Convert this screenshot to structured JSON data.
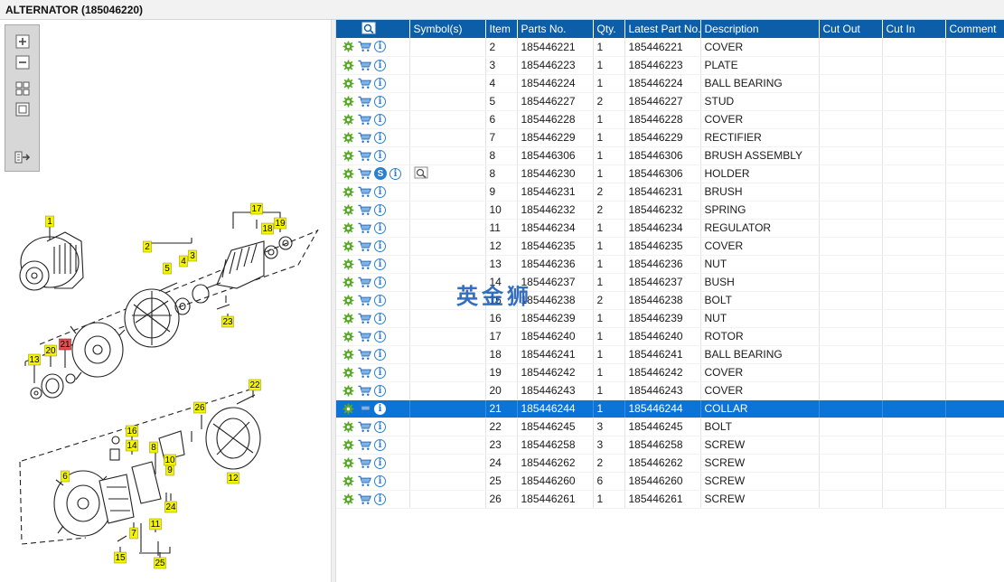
{
  "window": {
    "title": "ALTERNATOR (185046220)"
  },
  "toolbar": {
    "zoom_in": "zoom-in-icon",
    "zoom_out": "zoom-out-icon",
    "fit_all": "fit-all-icon",
    "fit_page": "fit-page-icon",
    "export": "export-icon"
  },
  "table": {
    "columns": [
      "",
      "Symbol(s)",
      "Item",
      "Parts No.",
      "Qty.",
      "Latest Part No.",
      "Description",
      "Cut Out",
      "Cut In",
      "Comment"
    ],
    "rows": [
      {
        "item": "2",
        "part": "185446221",
        "qty": "1",
        "latest": "185446221",
        "desc": "COVER"
      },
      {
        "item": "3",
        "part": "185446223",
        "qty": "1",
        "latest": "185446223",
        "desc": "PLATE"
      },
      {
        "item": "4",
        "part": "185446224",
        "qty": "1",
        "latest": "185446224",
        "desc": "BALL BEARING"
      },
      {
        "item": "5",
        "part": "185446227",
        "qty": "2",
        "latest": "185446227",
        "desc": "STUD"
      },
      {
        "item": "6",
        "part": "185446228",
        "qty": "1",
        "latest": "185446228",
        "desc": "COVER"
      },
      {
        "item": "7",
        "part": "185446229",
        "qty": "1",
        "latest": "185446229",
        "desc": "RECTIFIER"
      },
      {
        "item": "8",
        "part": "185446306",
        "qty": "1",
        "latest": "185446306",
        "desc": "BRUSH ASSEMBLY"
      },
      {
        "item": "8",
        "part": "185446230",
        "qty": "1",
        "latest": "185446306",
        "desc": "HOLDER",
        "has_s": true,
        "has_symbol": true
      },
      {
        "item": "9",
        "part": "185446231",
        "qty": "2",
        "latest": "185446231",
        "desc": "BRUSH"
      },
      {
        "item": "10",
        "part": "185446232",
        "qty": "2",
        "latest": "185446232",
        "desc": "SPRING"
      },
      {
        "item": "11",
        "part": "185446234",
        "qty": "1",
        "latest": "185446234",
        "desc": "REGULATOR"
      },
      {
        "item": "12",
        "part": "185446235",
        "qty": "1",
        "latest": "185446235",
        "desc": "COVER"
      },
      {
        "item": "13",
        "part": "185446236",
        "qty": "1",
        "latest": "185446236",
        "desc": "NUT"
      },
      {
        "item": "14",
        "part": "185446237",
        "qty": "1",
        "latest": "185446237",
        "desc": "BUSH"
      },
      {
        "item": "15",
        "part": "185446238",
        "qty": "2",
        "latest": "185446238",
        "desc": "BOLT"
      },
      {
        "item": "16",
        "part": "185446239",
        "qty": "1",
        "latest": "185446239",
        "desc": "NUT"
      },
      {
        "item": "17",
        "part": "185446240",
        "qty": "1",
        "latest": "185446240",
        "desc": "ROTOR"
      },
      {
        "item": "18",
        "part": "185446241",
        "qty": "1",
        "latest": "185446241",
        "desc": "BALL BEARING"
      },
      {
        "item": "19",
        "part": "185446242",
        "qty": "1",
        "latest": "185446242",
        "desc": "COVER"
      },
      {
        "item": "20",
        "part": "185446243",
        "qty": "1",
        "latest": "185446243",
        "desc": "COVER"
      },
      {
        "item": "21",
        "part": "185446244",
        "qty": "1",
        "latest": "185446244",
        "desc": "COLLAR",
        "selected": true
      },
      {
        "item": "22",
        "part": "185446245",
        "qty": "3",
        "latest": "185446245",
        "desc": "BOLT"
      },
      {
        "item": "23",
        "part": "185446258",
        "qty": "3",
        "latest": "185446258",
        "desc": "SCREW"
      },
      {
        "item": "24",
        "part": "185446262",
        "qty": "2",
        "latest": "185446262",
        "desc": "SCREW"
      },
      {
        "item": "25",
        "part": "185446260",
        "qty": "6",
        "latest": "185446260",
        "desc": "SCREW"
      },
      {
        "item": "26",
        "part": "185446261",
        "qty": "1",
        "latest": "185446261",
        "desc": "SCREW"
      }
    ]
  },
  "diagram": {
    "labels": [
      "1",
      "2",
      "3",
      "4",
      "5",
      "6",
      "7",
      "8",
      "9",
      "10",
      "11",
      "12",
      "13",
      "14",
      "15",
      "16",
      "17",
      "18",
      "19",
      "20",
      "21",
      "22",
      "23",
      "24",
      "25",
      "26"
    ],
    "active_label": "21"
  },
  "watermark": "英金狮",
  "colors": {
    "header": "#0c5ea8",
    "selected": "#0c74d6",
    "callout": "#f4f400",
    "callout_active": "#e05050"
  }
}
